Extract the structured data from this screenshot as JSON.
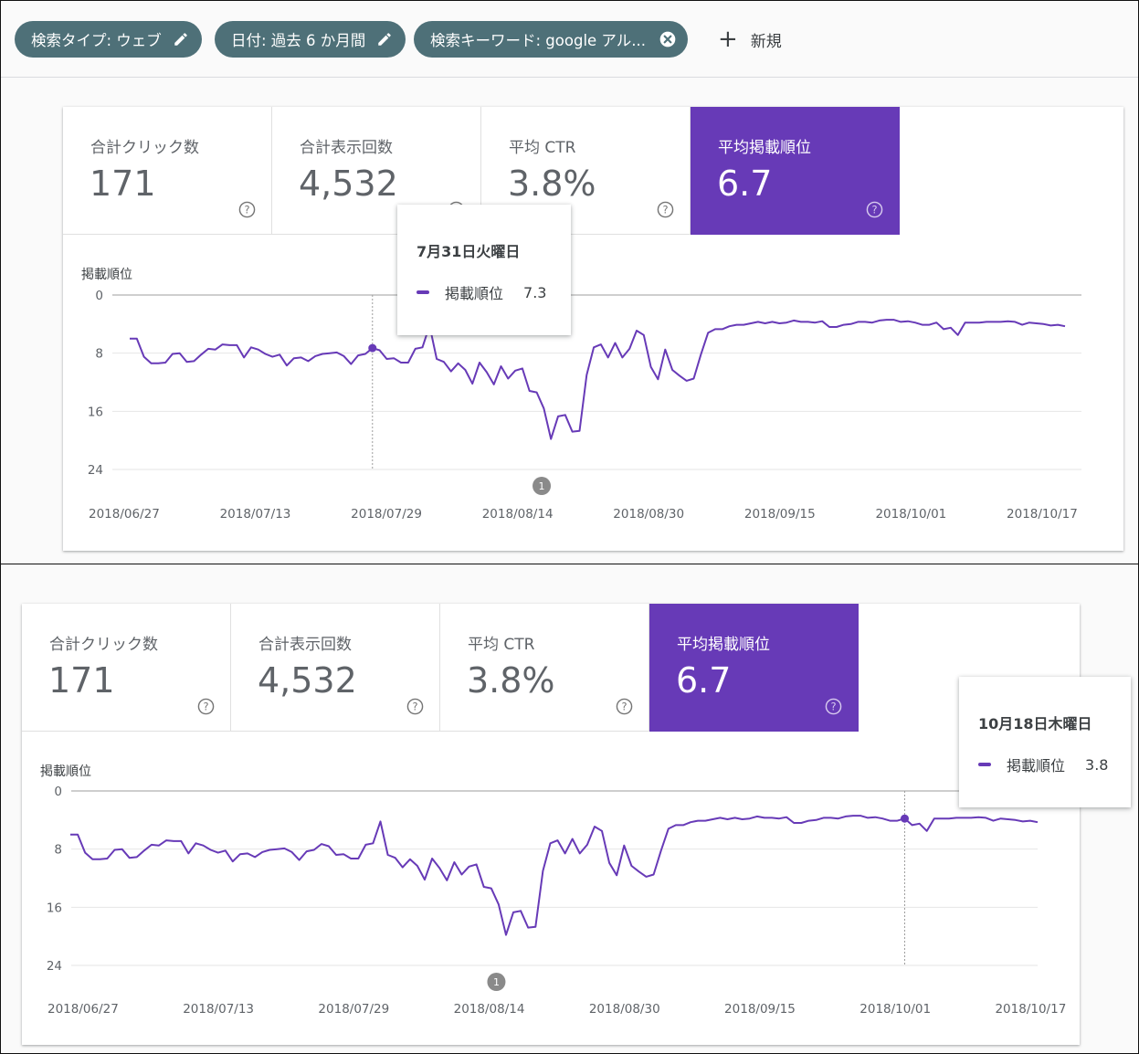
{
  "filters": {
    "chips": [
      {
        "label": "検索タイプ: ウェブ",
        "icon": "pencil-icon"
      },
      {
        "label": "日付: 過去 6 か月間",
        "icon": "pencil-icon"
      },
      {
        "label": "検索キーワード: google アル...",
        "icon": "close-circle-icon"
      }
    ],
    "new_label": "新規"
  },
  "metrics": [
    {
      "label": "合計クリック数",
      "value": "171",
      "active": false
    },
    {
      "label": "合計表示回数",
      "value": "4,532",
      "active": false
    },
    {
      "label": "平均 CTR",
      "value": "3.8%",
      "active": false
    },
    {
      "label": "平均掲載順位",
      "value": "6.7",
      "active": true
    }
  ],
  "colors": {
    "accent": "#673ab7",
    "chip": "#4e7078"
  },
  "panel1": {
    "tooltip": {
      "date": "7月31日火曜日",
      "series": "掲載順位",
      "value": "7.3"
    },
    "hover_index": 34,
    "annotation_label": "1"
  },
  "panel2": {
    "tooltip": {
      "date": "10月18日木曜日",
      "series": "掲載順位",
      "value": "3.8"
    },
    "hover_index": 113,
    "annotation_label": "1"
  },
  "chart_data": {
    "type": "line",
    "ylabel": "掲載順位",
    "y_inverted": true,
    "ylim": [
      0,
      24
    ],
    "yticks": [
      0,
      8,
      16,
      24
    ],
    "grid": true,
    "x_start": "2018/06/27",
    "x_end": "2018/11/02",
    "xtick_labels": [
      "2018/06/27",
      "2018/07/13",
      "2018/07/29",
      "2018/08/14",
      "2018/08/30",
      "2018/09/15",
      "2018/10/01",
      "2018/10/17"
    ],
    "series": [
      {
        "name": "掲載順位",
        "color": "#673ab7",
        "values": [
          6,
          6,
          8.5,
          9.4,
          9.4,
          9.3,
          8.1,
          8,
          9.2,
          9.1,
          8.2,
          7.4,
          7.5,
          6.8,
          6.9,
          6.9,
          8.6,
          7.2,
          7.5,
          8.1,
          8.5,
          8.2,
          9.7,
          8.7,
          8.6,
          9.1,
          8.4,
          8.1,
          8,
          7.9,
          8.4,
          9.5,
          8.3,
          8.1,
          7.3,
          7.6,
          8.8,
          8.7,
          9.3,
          9.3,
          7.4,
          7.2,
          4.2,
          8.8,
          9.2,
          10.5,
          9.4,
          10.3,
          12.2,
          9.3,
          10.6,
          12.3,
          9.8,
          11.5,
          10.4,
          10.1,
          13.2,
          13.4,
          15.6,
          19.8,
          16.7,
          16.5,
          18.8,
          18.7,
          11,
          7.2,
          6.8,
          8.6,
          6.6,
          8.6,
          7.4,
          4.9,
          5.5,
          9.9,
          11.6,
          7.5,
          10.3,
          11.1,
          11.8,
          11.5,
          8.2,
          5.2,
          4.7,
          4.7,
          4.3,
          4.1,
          4.1,
          3.9,
          3.7,
          3.9,
          3.7,
          3.9,
          3.8,
          3.5,
          3.7,
          3.7,
          3.8,
          3.6,
          4.4,
          4.4,
          4.1,
          4,
          3.7,
          3.7,
          3.8,
          3.5,
          3.4,
          3.4,
          3.7,
          3.6,
          3.8,
          4.1,
          4.1,
          3.8,
          4.7,
          4.5,
          5.5,
          3.8,
          3.8,
          3.8,
          3.7,
          3.7,
          3.7,
          3.6,
          3.7,
          4.1,
          3.8,
          3.9,
          4,
          4.2,
          4.1,
          4.3
        ]
      }
    ],
    "annotation": {
      "label": "1",
      "x_index": 58
    }
  }
}
